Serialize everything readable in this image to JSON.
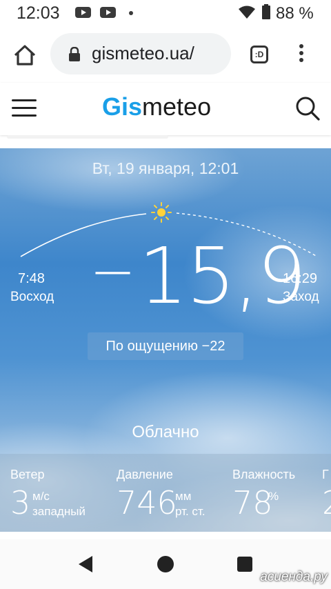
{
  "status_bar": {
    "time": "12:03",
    "battery": "88 %",
    "icons": [
      "youtube-icon",
      "youtube-icon",
      "dot-icon",
      "wifi-icon",
      "battery-icon"
    ]
  },
  "browser": {
    "url": "gismeteo.ua/",
    "tabs_count": ":D"
  },
  "site": {
    "logo_part1": "Gis",
    "logo_part2": "meteo",
    "logo_color": "#1a9fe8"
  },
  "weather": {
    "date": "Вт, 19 января, 12:01",
    "sunrise_time": "7:48",
    "sunrise_label": "Восход",
    "sunset_time": "16:29",
    "sunset_label": "Заход",
    "temp_sign": "−",
    "temperature": "15,9",
    "feels_like": "По ощущению −22",
    "condition": "Облачно"
  },
  "details": {
    "wind_label": "Ветер",
    "wind_value": "3",
    "wind_unit1": "м/с",
    "wind_unit2": "западный",
    "pressure_label": "Давление",
    "pressure_value": "746",
    "pressure_unit1": "мм",
    "pressure_unit2": "рт. ст.",
    "humidity_label": "Влажность",
    "humidity_value": "78",
    "humidity_unit": "%",
    "next_label": "Г",
    "next_value": "2"
  },
  "watermark": "асиенда.ру"
}
